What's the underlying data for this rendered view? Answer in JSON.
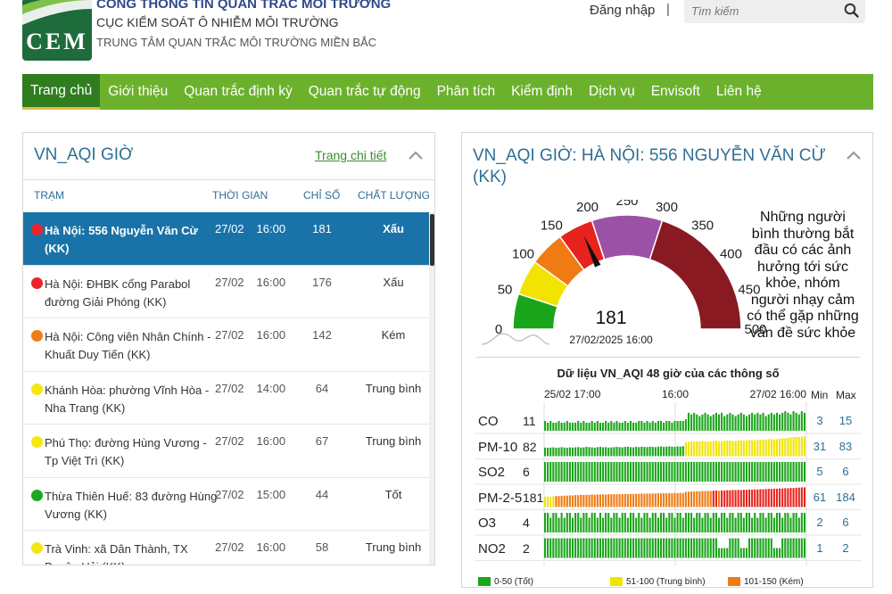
{
  "header": {
    "org_line1": "CỤC KIỂM SOÁT Ô NHIỄM MÔI TRƯỜNG",
    "org_line2": "TRUNG TÂM QUAN TRẮC MÔI TRƯỜNG MIỀN BẮC",
    "org_line0": "CỔNG THÔNG TIN QUAN TRẮC MÔI TRƯỜNG",
    "logo_text": "CEM",
    "login": "Đăng nhập",
    "separator": "|",
    "search_placeholder": "Tìm kiếm"
  },
  "nav": {
    "items": [
      "Trang chủ",
      "Giới thiệu",
      "Quan trắc định kỳ",
      "Quan trắc tự động",
      "Phân tích",
      "Kiểm định",
      "Dịch vụ",
      "Envisoft",
      "Liên hệ"
    ],
    "active_index": 0
  },
  "left_panel": {
    "title": "VN_AQI GIỜ",
    "detail_link": "Trang chi tiết",
    "columns": [
      "TRẠM",
      "THỜI GIAN",
      "CHỈ SỐ",
      "CHẤT LƯỢNG"
    ],
    "rows": [
      {
        "station": "Hà Nội: 556 Nguyễn Văn Cừ (KK)",
        "date": "27/02",
        "time": "16:00",
        "index": "181",
        "quality": "Xấu",
        "color": "#e8262b",
        "selected": true
      },
      {
        "station": "Hà Nội: ĐHBK cổng Parabol đường Giải Phóng (KK)",
        "date": "27/02",
        "time": "16:00",
        "index": "176",
        "quality": "Xấu",
        "color": "#e8262b",
        "selected": false
      },
      {
        "station": "Hà Nội: Công viên Nhân Chính - Khuất Duy Tiến (KK)",
        "date": "27/02",
        "time": "16:00",
        "index": "142",
        "quality": "Kém",
        "color": "#f07c1b",
        "selected": false
      },
      {
        "station": "Khánh Hòa: phường Vĩnh Hòa - Nha Trang (KK)",
        "date": "27/02",
        "time": "14:00",
        "index": "64",
        "quality": "Trung bình",
        "color": "#f5e614",
        "selected": false
      },
      {
        "station": "Phú Thọ: đường Hùng Vương - Tp Việt Trì (KK)",
        "date": "27/02",
        "time": "16:00",
        "index": "67",
        "quality": "Trung bình",
        "color": "#f5e614",
        "selected": false
      },
      {
        "station": "Thừa Thiên Huế: 83 đường Hùng Vương (KK)",
        "date": "27/02",
        "time": "15:00",
        "index": "44",
        "quality": "Tốt",
        "color": "#1fa81f",
        "selected": false
      },
      {
        "station": "Trà Vinh: xã Dân Thành, TX Duyên Hải (KK)",
        "date": "27/02",
        "time": "16:00",
        "index": "58",
        "quality": "Trung bình",
        "color": "#f5e614",
        "selected": false
      }
    ]
  },
  "right_panel": {
    "title": "VN_AQI GIỜ: HÀ NỘI: 556 NGUYỄN VĂN CỪ (KK)",
    "gauge": {
      "value": 181,
      "value_label": "181",
      "timestamp": "27/02/2025 16:00",
      "scale_labels": [
        "0",
        "50",
        "100",
        "150",
        "200",
        "250",
        "300",
        "350",
        "400",
        "450",
        "500"
      ],
      "bands": [
        {
          "from": 0,
          "to": 50,
          "color": "#1aa51a"
        },
        {
          "from": 50,
          "to": 100,
          "color": "#f2e300"
        },
        {
          "from": 100,
          "to": 150,
          "color": "#f07b12"
        },
        {
          "from": 150,
          "to": 200,
          "color": "#e8231d"
        },
        {
          "from": 200,
          "to": 300,
          "color": "#9b52a6"
        },
        {
          "from": 300,
          "to": 500,
          "color": "#8a1a22"
        }
      ]
    },
    "advice": "Những người bình thường bắt đầu có các ảnh hưởng tới sức khỏe, nhóm người nhạy cảm có thể gặp những vấn đề sức khỏe nghiêm trọng hơn",
    "params_title": "Dữ liệu VN_AQI 48 giờ của các thông số",
    "time_ticks": [
      "25/02 17:00",
      "16:00",
      "27/02 16:00"
    ],
    "min_label": "Min",
    "max_label": "Max",
    "params": [
      {
        "name": "CO",
        "value": "11",
        "min": "3",
        "max": "15",
        "bars": [
          6,
          5,
          6,
          5,
          5,
          6,
          5,
          5,
          6,
          5,
          5,
          5,
          6,
          5,
          6,
          5,
          5,
          6,
          5,
          6,
          5,
          5,
          6,
          5,
          6,
          5,
          6,
          5,
          5,
          6,
          5,
          6,
          5,
          5,
          6,
          6,
          5,
          6,
          5,
          6,
          5,
          6,
          6,
          5,
          6,
          6,
          5,
          6,
          6,
          6,
          6,
          7,
          11,
          10,
          11,
          10,
          9,
          10,
          11,
          10,
          9,
          10,
          11,
          10,
          11,
          9,
          10,
          11,
          10,
          9,
          10,
          11,
          10,
          9,
          10,
          11,
          10,
          11,
          10,
          11,
          9,
          10,
          11,
          10,
          11,
          10,
          11,
          12,
          11,
          10,
          12,
          11,
          10,
          12,
          11
        ]
      },
      {
        "name": "PM-10",
        "value": "82",
        "min": "31",
        "max": "83",
        "bars": [
          36,
          35,
          36,
          37,
          35,
          36,
          38,
          36,
          35,
          37,
          36,
          37,
          38,
          36,
          37,
          39,
          38,
          37,
          36,
          38,
          39,
          37,
          38,
          36,
          37,
          38,
          39,
          38,
          37,
          39,
          40,
          38,
          37,
          39,
          38,
          40,
          39,
          38,
          40,
          39,
          38,
          40,
          41,
          39,
          40,
          41,
          40,
          39,
          41,
          40,
          42,
          58,
          60,
          62,
          61,
          63,
          62,
          64,
          63,
          61,
          62,
          64,
          65,
          63,
          62,
          64,
          66,
          65,
          63,
          64,
          66,
          67,
          65,
          66,
          68,
          67,
          66,
          69,
          70,
          68,
          69,
          71,
          72,
          70,
          71,
          74,
          76,
          75,
          77,
          79,
          80,
          81,
          80,
          82,
          82
        ]
      },
      {
        "name": "SO2",
        "value": "6",
        "min": "5",
        "max": "6",
        "bars": [
          6,
          6,
          6,
          6,
          6,
          6,
          6,
          6,
          6,
          6,
          6,
          6,
          6,
          6,
          6,
          6,
          6,
          6,
          6,
          6,
          6,
          6,
          6,
          6,
          6,
          6,
          6,
          6,
          6,
          6,
          6,
          6,
          6,
          6,
          6,
          6,
          6,
          6,
          6,
          6,
          6,
          6,
          6,
          6,
          6,
          6,
          6,
          6,
          6,
          6,
          6,
          6,
          6,
          6,
          6,
          6,
          6,
          6,
          6,
          6,
          6,
          6,
          6,
          6,
          6,
          6,
          6,
          6,
          6,
          6,
          6,
          6,
          6,
          6,
          6,
          6,
          6,
          6,
          6,
          6,
          6,
          6,
          6,
          6,
          6,
          6,
          6,
          6,
          6,
          6,
          6,
          6,
          6,
          6,
          6
        ]
      },
      {
        "name": "PM-2-5",
        "value": "181",
        "min": "61",
        "max": "184",
        "bars": [
          95,
          98,
          96,
          100,
          102,
          101,
          104,
          106,
          105,
          108,
          107,
          110,
          109,
          112,
          111,
          113,
          112,
          115,
          114,
          116,
          115,
          117,
          116,
          118,
          117,
          119,
          118,
          120,
          119,
          121,
          120,
          122,
          121,
          123,
          122,
          124,
          123,
          125,
          124,
          126,
          125,
          127,
          126,
          128,
          127,
          129,
          128,
          130,
          129,
          131,
          130,
          140,
          142,
          144,
          143,
          146,
          145,
          148,
          147,
          149,
          148,
          151,
          152,
          150,
          153,
          152,
          155,
          154,
          157,
          156,
          158,
          157,
          160,
          159,
          162,
          161,
          163,
          162,
          165,
          164,
          166,
          168,
          167,
          170,
          169,
          172,
          171,
          174,
          173,
          176,
          175,
          178,
          179,
          181,
          181
        ]
      },
      {
        "name": "O3",
        "value": "4",
        "min": "2",
        "max": "6",
        "bars": [
          4,
          4,
          3,
          4,
          4,
          3,
          4,
          3,
          4,
          4,
          3,
          4,
          4,
          3,
          4,
          4,
          3,
          4,
          4,
          3,
          4,
          3,
          4,
          4,
          3,
          4,
          4,
          3,
          4,
          4,
          3,
          4,
          4,
          3,
          4,
          3,
          4,
          4,
          3,
          4,
          4,
          3,
          4,
          4,
          3,
          4,
          4,
          3,
          4,
          4,
          3,
          4,
          4,
          4,
          3,
          4,
          4,
          3,
          4,
          4,
          3,
          4,
          4,
          3,
          4,
          4,
          3,
          4,
          4,
          3,
          4,
          4,
          3,
          4,
          4,
          3,
          4,
          3,
          4,
          4,
          3,
          4,
          4,
          3,
          4,
          4,
          3,
          4,
          4,
          3,
          4,
          4,
          3,
          4,
          4
        ]
      },
      {
        "name": "NO2",
        "value": "2",
        "min": "1",
        "max": "2",
        "bars": [
          2,
          2,
          2,
          2,
          2,
          2,
          2,
          2,
          2,
          2,
          2,
          2,
          2,
          2,
          2,
          2,
          2,
          2,
          2,
          2,
          2,
          2,
          2,
          2,
          2,
          2,
          2,
          2,
          2,
          2,
          2,
          2,
          2,
          2,
          2,
          2,
          2,
          2,
          2,
          2,
          2,
          2,
          2,
          2,
          2,
          2,
          2,
          2,
          2,
          2,
          2,
          2,
          2,
          2,
          2,
          2,
          2,
          2,
          2,
          2,
          2,
          2,
          2,
          1,
          1,
          1,
          1,
          2,
          2,
          2,
          2,
          1,
          1,
          1,
          2,
          2,
          2,
          2,
          2,
          2,
          2,
          2,
          2,
          1,
          1,
          1,
          2,
          2,
          2,
          2,
          2,
          2,
          2,
          2,
          2
        ]
      }
    ],
    "legend": [
      {
        "label": "0-50 (Tốt)",
        "color": "#1aa51a"
      },
      {
        "label": "51-100 (Trung bình)",
        "color": "#f2e300"
      },
      {
        "label": "101-150 (Kém)",
        "color": "#f07b12"
      }
    ]
  }
}
